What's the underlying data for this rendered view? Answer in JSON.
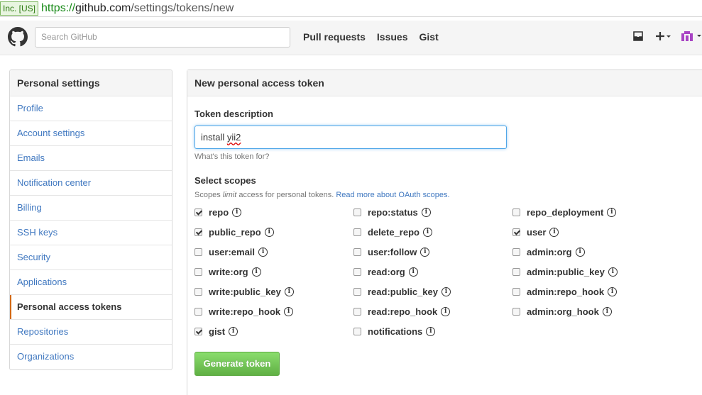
{
  "browser": {
    "ev_label": "Inc. [US]",
    "url_scheme": "https://",
    "url_domain": "github.com",
    "url_path": "/settings/tokens/new"
  },
  "header": {
    "search_placeholder": "Search GitHub",
    "nav": [
      "Pull requests",
      "Issues",
      "Gist"
    ],
    "icons": [
      "octocat-icon",
      "inbox-icon",
      "plus-icon",
      "avatar"
    ]
  },
  "sidebar": {
    "title": "Personal settings",
    "items": [
      {
        "label": "Profile"
      },
      {
        "label": "Account settings"
      },
      {
        "label": "Emails"
      },
      {
        "label": "Notification center"
      },
      {
        "label": "Billing"
      },
      {
        "label": "SSH keys"
      },
      {
        "label": "Security"
      },
      {
        "label": "Applications"
      },
      {
        "label": "Personal access tokens",
        "active": true
      },
      {
        "label": "Repositories"
      },
      {
        "label": "Organizations"
      }
    ]
  },
  "main": {
    "title": "New personal access token",
    "token_label": "Token description",
    "token_value_plain": "install ",
    "token_value_misspelled": "yii2",
    "token_help": "What's this token for?",
    "scopes_label": "Select scopes",
    "scopes_help_pre": "Scopes ",
    "scopes_help_em": "limit",
    "scopes_help_post": " access for personal tokens. ",
    "scopes_help_link": "Read more about OAuth scopes.",
    "scopes": [
      {
        "name": "repo",
        "checked": true
      },
      {
        "name": "repo:status",
        "checked": false
      },
      {
        "name": "repo_deployment",
        "checked": false
      },
      {
        "name": "public_repo",
        "checked": true
      },
      {
        "name": "delete_repo",
        "checked": false
      },
      {
        "name": "user",
        "checked": true
      },
      {
        "name": "user:email",
        "checked": false
      },
      {
        "name": "user:follow",
        "checked": false
      },
      {
        "name": "admin:org",
        "checked": false
      },
      {
        "name": "write:org",
        "checked": false
      },
      {
        "name": "read:org",
        "checked": false
      },
      {
        "name": "admin:public_key",
        "checked": false
      },
      {
        "name": "write:public_key",
        "checked": false
      },
      {
        "name": "read:public_key",
        "checked": false
      },
      {
        "name": "admin:repo_hook",
        "checked": false
      },
      {
        "name": "write:repo_hook",
        "checked": false
      },
      {
        "name": "read:repo_hook",
        "checked": false
      },
      {
        "name": "admin:org_hook",
        "checked": false
      },
      {
        "name": "gist",
        "checked": true
      },
      {
        "name": "notifications",
        "checked": false
      }
    ],
    "generate_label": "Generate token"
  },
  "colors": {
    "link": "#4078c0",
    "accent_bar": "#d26911",
    "button_green": "#60b044"
  }
}
